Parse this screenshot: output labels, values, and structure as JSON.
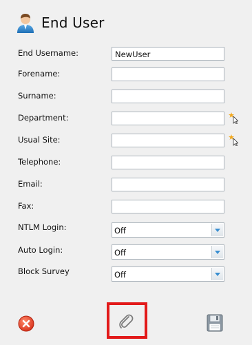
{
  "header": {
    "title": "End User",
    "icon": "user-icon"
  },
  "form": {
    "end_username": {
      "label": "End Username:",
      "value": "NewUser"
    },
    "forename": {
      "label": "Forename:",
      "value": ""
    },
    "surname": {
      "label": "Surname:",
      "value": ""
    },
    "department": {
      "label": "Department:",
      "value": "",
      "icon": "lookup-picker-icon"
    },
    "usual_site": {
      "label": "Usual Site:",
      "value": "",
      "icon": "lookup-picker-icon"
    },
    "telephone": {
      "label": "Telephone:",
      "value": ""
    },
    "email": {
      "label": "Email:",
      "value": ""
    },
    "fax": {
      "label": "Fax:",
      "value": ""
    },
    "ntlm_login": {
      "label": "NTLM Login:",
      "value": "Off"
    },
    "auto_login": {
      "label": "Auto Login:",
      "value": "Off"
    },
    "block_survey": {
      "label": "Block Survey",
      "value": "Off"
    }
  },
  "footer": {
    "cancel_icon": "cancel-icon",
    "attach_icon": "paperclip-icon",
    "save_icon": "save-disk-icon"
  },
  "colors": {
    "highlight": "#e21a1a",
    "cancel": "#e8462c",
    "accent": "#3a8fd1"
  }
}
